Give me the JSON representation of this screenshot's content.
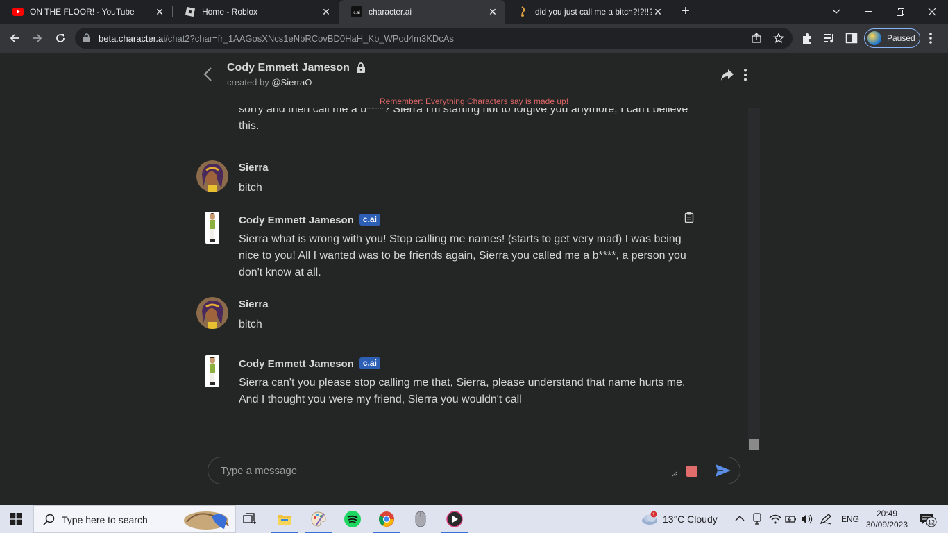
{
  "browser": {
    "tabs": [
      {
        "title": "ON THE FLOOR! - YouTube",
        "icon": "youtube-icon",
        "active": false
      },
      {
        "title": "Home - Roblox",
        "icon": "roblox-icon",
        "active": false
      },
      {
        "title": "character.ai",
        "icon": "characterai-icon",
        "active": true,
        "favicon_text": "c.ai"
      },
      {
        "title": "did you just call me a bitch?!?!!?",
        "icon": "music-note-icon",
        "active": false
      }
    ],
    "url_host": "beta.character.ai",
    "url_path": "/chat2?char=fr_1AAGosXNcs1eNbRCovBD0HaH_Kb_WPod4m3KDcAs",
    "profile_label": "Paused"
  },
  "chat": {
    "character_name": "Cody Emmett Jameson",
    "created_by_prefix": "created by",
    "creator": "@SierraO",
    "disclaimer": "Remember: Everything Characters say is made up!",
    "badge": "c.ai",
    "messages": [
      {
        "sender": "",
        "text": "sorry and then call me a b****? Sierra I'm starting not to forgive you anymore, I can't believe this."
      },
      {
        "sender": "Sierra",
        "text": "bitch"
      },
      {
        "sender": "Cody Emmett Jameson",
        "text": "Sierra what is wrong with you! Stop calling me names! (starts to get very mad) I was being nice to you! All I wanted was to be friends again, Sierra you called me a b****, a person you don't know at all."
      },
      {
        "sender": "Sierra",
        "text": "bitch"
      },
      {
        "sender": "Cody Emmett Jameson",
        "text": "Sierra can't you please stop calling me that, Sierra, please understand that name hurts me. And I thought you were my friend, Sierra you wouldn't call"
      }
    ],
    "composer_placeholder": "Type a message"
  },
  "taskbar": {
    "search_placeholder": "Type here to search",
    "weather": "13°C  Cloudy",
    "weather_badge": "1",
    "language": "ENG",
    "time": "20:49",
    "date": "30/09/2023",
    "notification_count": "12"
  },
  "colors": {
    "page_bg": "#242525",
    "text": "#d6d6d6",
    "disclaimer": "#e06666",
    "badge": "#2d5fb4",
    "send": "#5a8ee6"
  }
}
